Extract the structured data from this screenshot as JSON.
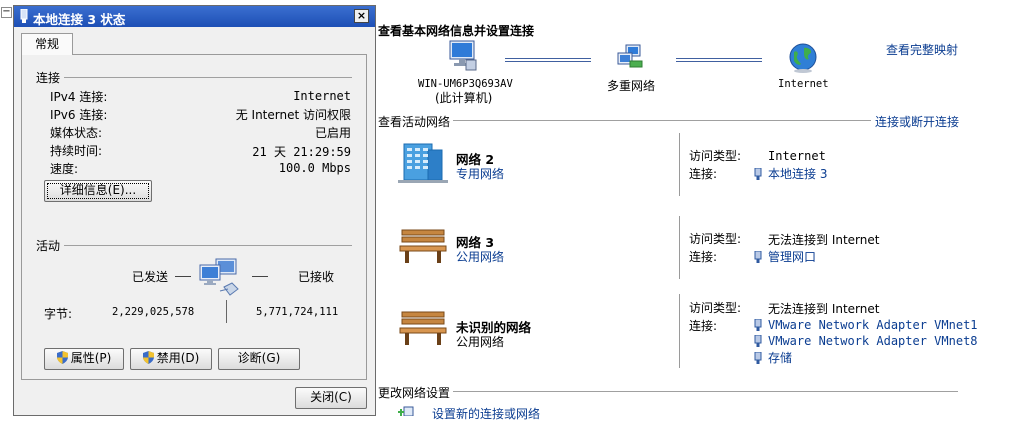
{
  "dialog": {
    "title": "本地连接 3 状态",
    "close_glyph": "×",
    "tab": "常规",
    "connection": {
      "heading": "连接",
      "rows": [
        {
          "label": "IPv4 连接:",
          "value": "Internet"
        },
        {
          "label": "IPv6 连接:",
          "value": "无 Internet 访问权限"
        },
        {
          "label": "媒体状态:",
          "value": "已启用"
        },
        {
          "label": "持续时间:",
          "value": "21 天 21:29:59"
        },
        {
          "label": "速度:",
          "value": "100.0 Mbps"
        }
      ],
      "details_button": "详细信息(E)..."
    },
    "activity": {
      "heading": "活动",
      "sent_label": "已发送",
      "recv_label": "已接收",
      "bytes_label": "字节:",
      "bytes_sent": "2,229,025,578",
      "bytes_received": "5,771,724,111"
    },
    "buttons": {
      "properties": "属性(P)",
      "disable": "禁用(D)",
      "diagnose": "诊断(G)",
      "close": "关闭(C)"
    }
  },
  "nsc": {
    "title": "查看基本网络信息并设置连接",
    "full_map_link": "查看完整映射",
    "map": {
      "computer_name": "WIN-UM6P3Q693AV",
      "computer_sub": "(此计算机)",
      "middle": "多重网络",
      "internet": "Internet"
    },
    "active_label": "查看活动网络",
    "connect_disconnect_link": "连接或断开连接",
    "networks": [
      {
        "name": "网络  2",
        "category": "专用网络",
        "access_label": "访问类型:",
        "access_value": "Internet",
        "conn_label": "连接:",
        "connections": [
          "本地连接 3"
        ]
      },
      {
        "name": "网络  3",
        "category": "公用网络",
        "access_label": "访问类型:",
        "access_value": "无法连接到 Internet",
        "conn_label": "连接:",
        "connections": [
          "管理网口"
        ]
      },
      {
        "name": "未识别的网络",
        "category": "公用网络",
        "access_label": "访问类型:",
        "access_value": "无法连接到 Internet",
        "conn_label": "连接:",
        "connections": [
          "VMware Network Adapter VMnet1",
          "VMware Network Adapter VMnet8",
          "存储"
        ]
      }
    ],
    "change_settings_label": "更改网络设置",
    "setup_new_link": "设置新的连接或网络"
  }
}
